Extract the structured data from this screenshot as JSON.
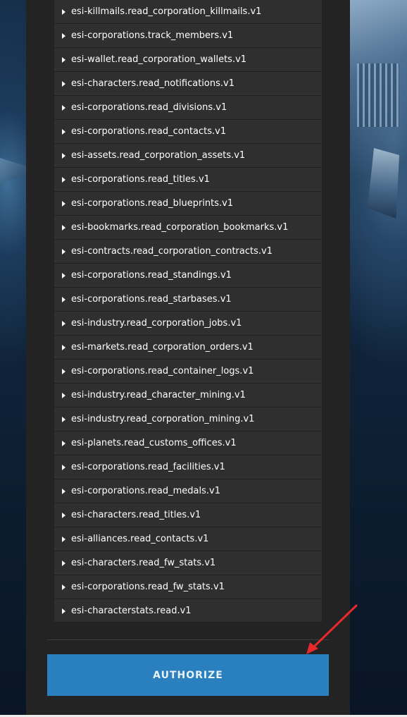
{
  "scopes": [
    "esi-killmails.read_corporation_killmails.v1",
    "esi-corporations.track_members.v1",
    "esi-wallet.read_corporation_wallets.v1",
    "esi-characters.read_notifications.v1",
    "esi-corporations.read_divisions.v1",
    "esi-corporations.read_contacts.v1",
    "esi-assets.read_corporation_assets.v1",
    "esi-corporations.read_titles.v1",
    "esi-corporations.read_blueprints.v1",
    "esi-bookmarks.read_corporation_bookmarks.v1",
    "esi-contracts.read_corporation_contracts.v1",
    "esi-corporations.read_standings.v1",
    "esi-corporations.read_starbases.v1",
    "esi-industry.read_corporation_jobs.v1",
    "esi-markets.read_corporation_orders.v1",
    "esi-corporations.read_container_logs.v1",
    "esi-industry.read_character_mining.v1",
    "esi-industry.read_corporation_mining.v1",
    "esi-planets.read_customs_offices.v1",
    "esi-corporations.read_facilities.v1",
    "esi-corporations.read_medals.v1",
    "esi-characters.read_titles.v1",
    "esi-alliances.read_contacts.v1",
    "esi-characters.read_fw_stats.v1",
    "esi-corporations.read_fw_stats.v1",
    "esi-characterstats.read.v1"
  ],
  "authorize": {
    "label": "AUTHORIZE",
    "color": "#2a7fbf"
  },
  "annotation": {
    "color": "#e8282b"
  }
}
